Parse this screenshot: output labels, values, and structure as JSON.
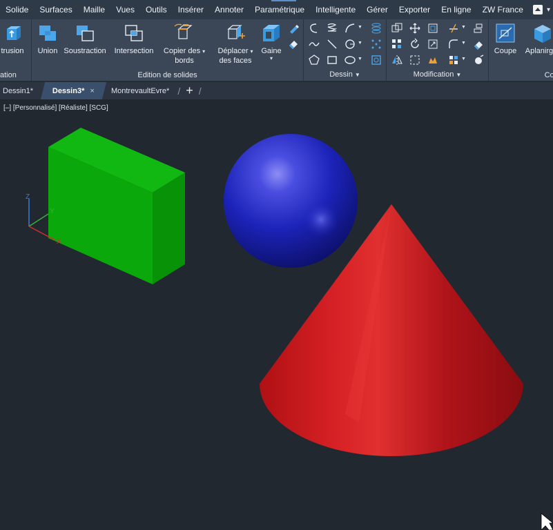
{
  "menu": {
    "items": [
      "Solide",
      "Surfaces",
      "Maille",
      "Vues",
      "Outils",
      "Insérer",
      "Annoter",
      "Paramétrique",
      "Intelligente",
      "Gérer",
      "Exporter",
      "En ligne",
      "ZW France"
    ]
  },
  "ribbon": {
    "panels": {
      "creation": {
        "title": "ation",
        "extrusion_label": "trusion"
      },
      "edition": {
        "title": "Edition de solides",
        "union_label": "Union",
        "soustraction_label": "Soustraction",
        "intersection_label": "Intersection",
        "copier_line1": "Copier des",
        "copier_line2": "bords",
        "deplacer_line1": "Déplacer",
        "deplacer_line2": "des faces",
        "gaine_label": "Gaine"
      },
      "dessin": {
        "title": "Dessin"
      },
      "modification": {
        "title": "Modification"
      },
      "coupe": {
        "title": "Coupe",
        "coupe_label": "Coupe",
        "aplanir_label": "Aplanirge"
      }
    }
  },
  "tabs": {
    "dessin1": "Dessin1*",
    "dessin3": "Dessin3*",
    "close": "×",
    "montrevault": "MontrevaultEvre*",
    "new": "+"
  },
  "viewport": {
    "label": "[–] [Personnalisé] [Réaliste] [SCG]",
    "axes": {
      "x": "X",
      "y": "Y",
      "z": "Z"
    }
  },
  "colors": {
    "box": "#0aa80a",
    "sphere": "#1c23b8",
    "cone": "#c8161a",
    "background": "#212830",
    "ribbon": "#3b4757",
    "menubar": "#2f3a49"
  }
}
